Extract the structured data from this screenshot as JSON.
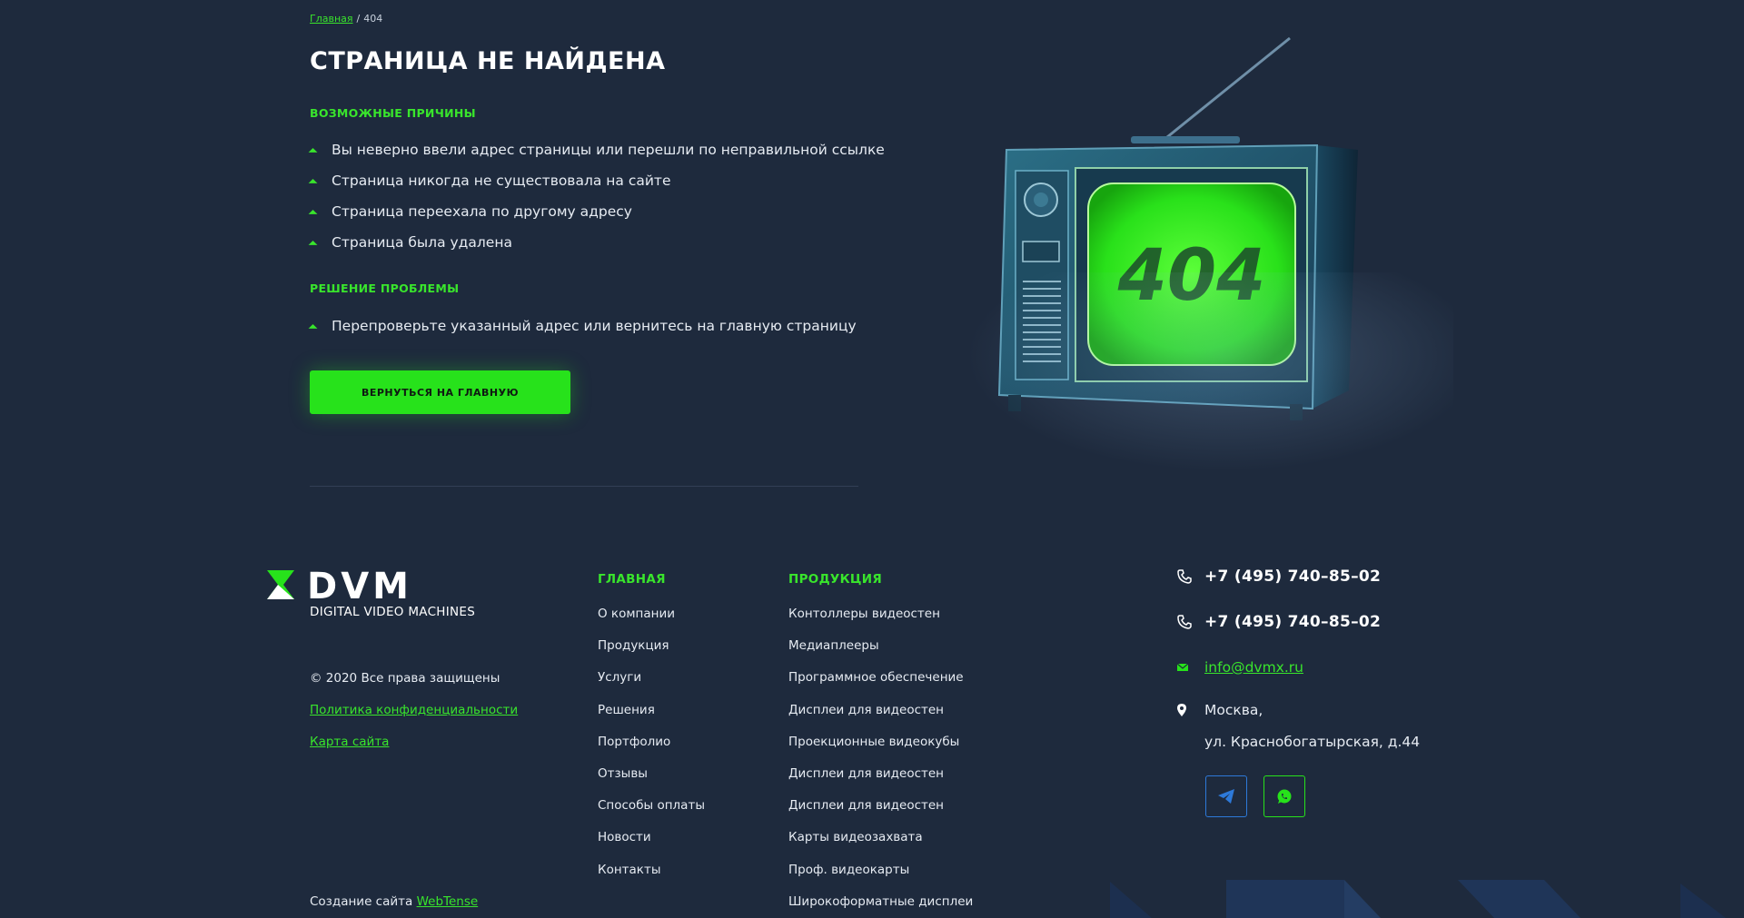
{
  "breadcrumb": {
    "home": "Главная",
    "separator": "/",
    "current": "404"
  },
  "title": "СТРАНИЦА НЕ НАЙДЕНА",
  "reasons": {
    "heading": "ВОЗМОЖНЫЕ ПРИЧИНЫ",
    "items": [
      "Вы неверно ввели адрес страницы или перешли по неправильной ссылке",
      "Страница никогда не существовала на сайте",
      "Страница переехала по другому адресу",
      "Страница была удалена"
    ]
  },
  "solution": {
    "heading": "РЕШЕНИЕ ПРОБЛЕМЫ",
    "items": [
      "Перепроверьте указанный адрес или вернитесь на главную страницу"
    ]
  },
  "cta": {
    "label": "ВЕРНУТЬСЯ НА ГЛАВНУЮ"
  },
  "tv": {
    "screen_text": "404"
  },
  "colors": {
    "accent": "#27e21b",
    "background": "#1e2a3d",
    "telegram": "#2d79d9"
  },
  "footer": {
    "logo": {
      "text": "DVM",
      "subtitle": "DIGITAL VIDEO MACHINES"
    },
    "copyright": "© 2020 Все права защищены",
    "privacy": "Политика конфиденциальности",
    "sitemap": "Карта сайта",
    "credit": {
      "text": "Создание сайта",
      "link": "WebTense"
    },
    "main_col": {
      "heading": "ГЛАВНАЯ",
      "items": [
        "О компании",
        "Продукция",
        "Услуги",
        "Решения",
        "Портфолио",
        "Отзывы",
        "Способы оплаты",
        "Новости",
        "Контакты"
      ]
    },
    "products_col": {
      "heading": "ПРОДУКЦИЯ",
      "items": [
        "Контоллеры видеостен",
        "Медиаплееры",
        "Программное обеспечение",
        "Дисплеи для видеостен",
        "Проекционные видеокубы",
        "Дисплеи для видеостен",
        "Дисплеи для видеостен",
        "Карты видеозахвата",
        "Проф. видеокарты",
        "Широкоформатные дисплеи"
      ]
    },
    "contacts": {
      "phone1": "+7 (495) 740–85–02",
      "phone2": "+7 (495) 740–85–02",
      "email": "info@dvmx.ru",
      "address_line1": "Москва,",
      "address_line2": "ул. Краснобогатырская, д.44",
      "icons": [
        "phone-icon",
        "phone-icon",
        "mail-icon",
        "location-pin-icon"
      ],
      "social": [
        "telegram-icon",
        "whatsapp-icon"
      ]
    }
  }
}
